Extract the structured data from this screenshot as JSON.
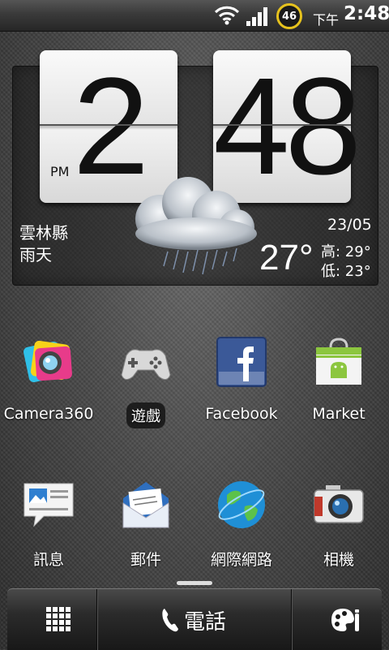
{
  "status_bar": {
    "battery_level": "46",
    "ampm": "下午",
    "time": "2:48",
    "icons": [
      "wifi-icon",
      "signal-icon",
      "battery-icon"
    ]
  },
  "clock_widget": {
    "hour": "2",
    "minute": "48",
    "period": "PM",
    "location": "雲林縣",
    "condition": "雨天",
    "date": "23/05",
    "temperature": "27°",
    "high": "高: 29°",
    "low": "低: 23°",
    "weather_icon": "rain-cloud-icon"
  },
  "apps": [
    {
      "label": "Camera360",
      "icon": "camera360-icon"
    },
    {
      "label": "遊戲",
      "icon": "gamepad-icon"
    },
    {
      "label": "Facebook",
      "icon": "facebook-icon"
    },
    {
      "label": "Market",
      "icon": "market-icon"
    },
    {
      "label": "訊息",
      "icon": "messages-icon"
    },
    {
      "label": "郵件",
      "icon": "mail-icon"
    },
    {
      "label": "網際網路",
      "icon": "globe-icon"
    },
    {
      "label": "相機",
      "icon": "camera-icon"
    }
  ],
  "dock": {
    "phone_label": "電話",
    "icons": [
      "all-apps-icon",
      "phone-icon",
      "personalize-icon"
    ]
  },
  "colors": {
    "battery_ring": "#e6c21d",
    "facebook_blue": "#3b5998"
  }
}
